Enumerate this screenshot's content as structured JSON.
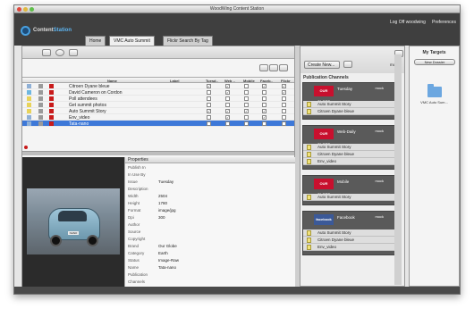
{
  "window": {
    "title": "WoodWing Content Station"
  },
  "header": {
    "logo_content": "Content",
    "logo_station": "Station",
    "logoff": "Log Off woodwing",
    "preferences": "Preferences"
  },
  "tabs": [
    {
      "label": "Home"
    },
    {
      "label": "VMC Auto Summit"
    },
    {
      "label": "Flickr Search By Tag"
    }
  ],
  "table": {
    "headers": {
      "name": "Name",
      "label": "Label",
      "c1": "Tuesd..",
      "c2": "Web ..",
      "c3": "Mobile",
      "c4": "Faceb..",
      "c5": "Flickr"
    },
    "rows": [
      {
        "name": "Citroen Dyane bleue",
        "checks": [
          "✓",
          "✓",
          "",
          "✓",
          "✓"
        ]
      },
      {
        "name": "David Cameron on Cordon",
        "checks": [
          "",
          "✓",
          "",
          "",
          "✓"
        ]
      },
      {
        "name": "Poll attendees",
        "checks": [
          "",
          "",
          "",
          "",
          ""
        ]
      },
      {
        "name": "Get summit photos",
        "checks": [
          "",
          "",
          "",
          "",
          ""
        ]
      },
      {
        "name": "Auto Summit Story",
        "checks": [
          "✓",
          "✓",
          "✓",
          "✓",
          ""
        ]
      },
      {
        "name": "Env_video",
        "checks": [
          "",
          "✓",
          "",
          "✓",
          ""
        ]
      },
      {
        "name": "Tata-nano",
        "checks": [
          "",
          "",
          "",
          "",
          ""
        ]
      }
    ]
  },
  "properties": {
    "title": "Properties",
    "fields": [
      {
        "label": "Publish In",
        "value": ""
      },
      {
        "label": "In Use By",
        "value": ""
      },
      {
        "label": "Issue",
        "value": "Tuesday"
      },
      {
        "label": "Description",
        "value": ""
      },
      {
        "label": "Width",
        "value": "2504"
      },
      {
        "label": "Height",
        "value": "1780"
      },
      {
        "label": "Format",
        "value": "image/jpg"
      },
      {
        "label": "Dpi",
        "value": "300"
      },
      {
        "label": "Author",
        "value": ""
      },
      {
        "label": "Source",
        "value": ""
      },
      {
        "label": "Copyright",
        "value": ""
      },
      {
        "label": "Brand",
        "value": "Our Globe"
      },
      {
        "label": "Category",
        "value": "Earth"
      },
      {
        "label": "Status",
        "value": "Image-Raw"
      },
      {
        "label": "Name",
        "value": "Tata-nano"
      },
      {
        "label": "Publication",
        "value": ""
      },
      {
        "label": "Channels",
        "value": ""
      }
    ]
  },
  "preview": {
    "plate": "NANO"
  },
  "channels": {
    "create_label": "Create New...",
    "more_label": "more",
    "section_label": "Publication Channels",
    "pubs": [
      {
        "brand": "OUR GLOBE",
        "name": "Tuesday",
        "mock": "mock",
        "items": [
          "Auto Summit Story",
          "Citroen Dyane bleue"
        ]
      },
      {
        "brand": "OUR GLOBE",
        "name": "Web-Daily",
        "mock": "mock",
        "items": [
          "Auto Summit Story",
          "Citroen Dyane bleue",
          "Env_video"
        ]
      },
      {
        "brand": "OUR GLOBE",
        "name": "Mobile",
        "mock": "mock",
        "items": [
          "Auto Summit Story"
        ]
      },
      {
        "brand": "facebook",
        "name": "Facebook",
        "mock": "mock",
        "items": [
          "Auto Summit Story",
          "Citroen Dyane bleue",
          "Env_video"
        ]
      }
    ]
  },
  "targets": {
    "title": "My Targets",
    "new_dossier": "New Dossier",
    "folder_label": "VMC Auto Sum..."
  },
  "colors": {
    "selected_row": "#3d78d8",
    "header_bg": "#3f3f3f",
    "ourglobe": "#c8102e",
    "facebook": "#3b5998"
  }
}
